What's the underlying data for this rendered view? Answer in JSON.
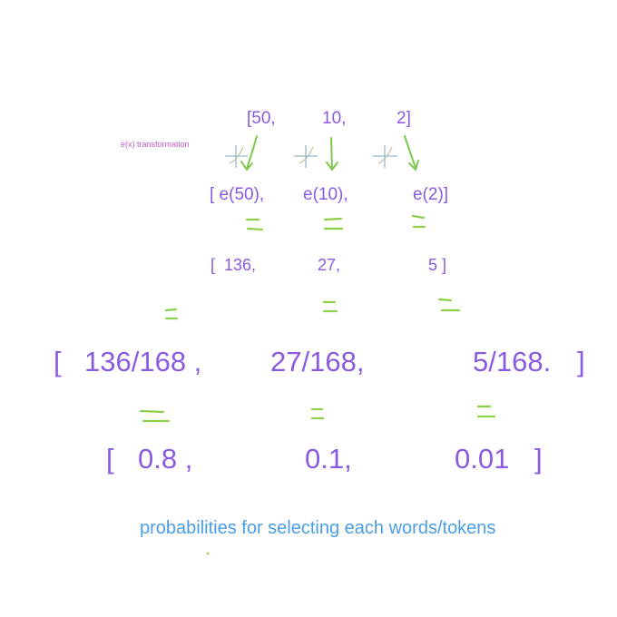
{
  "colors": {
    "text": "#8a5be0",
    "equals": "#8fd04a",
    "arrow": "#7ec850",
    "note": "#c45ac8",
    "caption": "#4a9ee6",
    "graph_axis": "#9bb7c9"
  },
  "rows": {
    "logits": [
      "[50,",
      "10,",
      "2]"
    ],
    "exp_terms": [
      "[ e(50),",
      "e(10),",
      "e(2)]"
    ],
    "exp_values": [
      "[  136,",
      "27,",
      "5 ]"
    ],
    "fractions": [
      "[",
      "136/168 ,",
      "27/168,",
      "5/168.",
      "]"
    ],
    "probabilities": [
      "[",
      "0.8 ,",
      "0.1,",
      "0.01",
      "]"
    ]
  },
  "labels": {
    "transformation": "e(x) transformation",
    "caption": "probabilities for selecting each words/tokens"
  },
  "icons": [
    "exp-graph-icon",
    "arrow-down-icon",
    "equals-sign-icon"
  ]
}
